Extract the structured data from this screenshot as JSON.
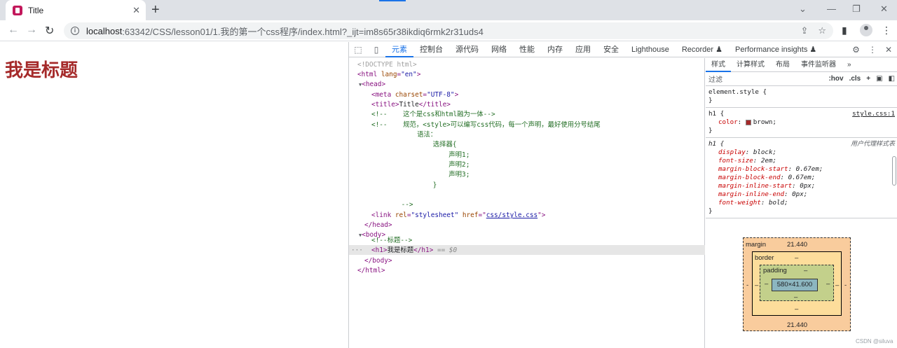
{
  "browser": {
    "tab_title": "Title",
    "tab_close": "✕",
    "new_tab": "+",
    "window_controls": [
      "⌄",
      "—",
      "❐",
      "✕"
    ],
    "url_host": "localhost",
    "url_rest": ":63342/CSS/lesson01/1.我的第一个css程序/index.html?_ijt=im8s65r38ikdiq6rmk2r31uds4"
  },
  "page": {
    "h1": "我是标题"
  },
  "devtools": {
    "tabs": [
      "元素",
      "控制台",
      "源代码",
      "网络",
      "性能",
      "内存",
      "应用",
      "安全",
      "Lighthouse",
      "Recorder ♟",
      "Performance insights ♟"
    ],
    "active_tab": "元素",
    "html": {
      "doctype": "<!DOCTYPE html>",
      "html_open": "<html",
      "lang_attr": "lang",
      "lang_val": "\"en\"",
      "head_open": "<head>",
      "meta_open": "<meta",
      "charset_attr": "charset",
      "charset_val": "\"UTF-8\"",
      "title_open": "<title>",
      "title_text": "Title",
      "title_close": "</title>",
      "comment1": "<!--    这个是css和html融为一体-->",
      "comment2a": "<!--    规范，<style>可以编写css代码，每一个声明，最好使用分号结尾",
      "comment2b": "        语法：",
      "comment2c": "            选择器{",
      "comment2d": "                声明1;",
      "comment2e": "                声明2;",
      "comment2f": "                声明3;",
      "comment2g": "            }",
      "comment2h": "    -->",
      "link_open": "<link",
      "rel_attr": "rel",
      "rel_val": "\"stylesheet\"",
      "href_attr": "href",
      "href_val": "css/style.css",
      "head_close": "</head>",
      "body_open": "<body>",
      "comment3": "<!--标题-->",
      "h1_open": "<h1>",
      "h1_text": "我是标题",
      "h1_close": "</h1>",
      "h1_eq": " == $0",
      "body_close": "</body>",
      "html_close": "</html>",
      "dots": "···"
    },
    "styles": {
      "tabs": [
        "样式",
        "计算样式",
        "布局",
        "事件监听器",
        "»"
      ],
      "filter_placeholder": "过滤",
      "hov": ":hov",
      "cls": ".cls",
      "plus": "+",
      "element_style": "element.style {",
      "close_brace": "}",
      "h1_rule_sel": "h1 {",
      "h1_rule_src": "style.css:1",
      "color_prop": "color",
      "color_val": "brown;",
      "ua_sel": "h1 {",
      "ua_label": "用户代理样式表",
      "ua_props": [
        {
          "p": "display",
          "v": "block;"
        },
        {
          "p": "font-size",
          "v": "2em;"
        },
        {
          "p": "margin-block-start",
          "v": "0.67em;"
        },
        {
          "p": "margin-block-end",
          "v": "0.67em;"
        },
        {
          "p": "margin-inline-start",
          "v": "0px;"
        },
        {
          "p": "margin-inline-end",
          "v": "0px;"
        },
        {
          "p": "font-weight",
          "v": "bold;"
        }
      ]
    },
    "box_model": {
      "margin_label": "margin",
      "margin_top": "21.440",
      "margin_bottom": "21.440",
      "margin_side": "-",
      "border_label": "border",
      "border_dash": "–",
      "padding_label": "padding",
      "padding_dash": "–",
      "content": "580×41.600"
    }
  },
  "watermark": "CSDN @siluva"
}
